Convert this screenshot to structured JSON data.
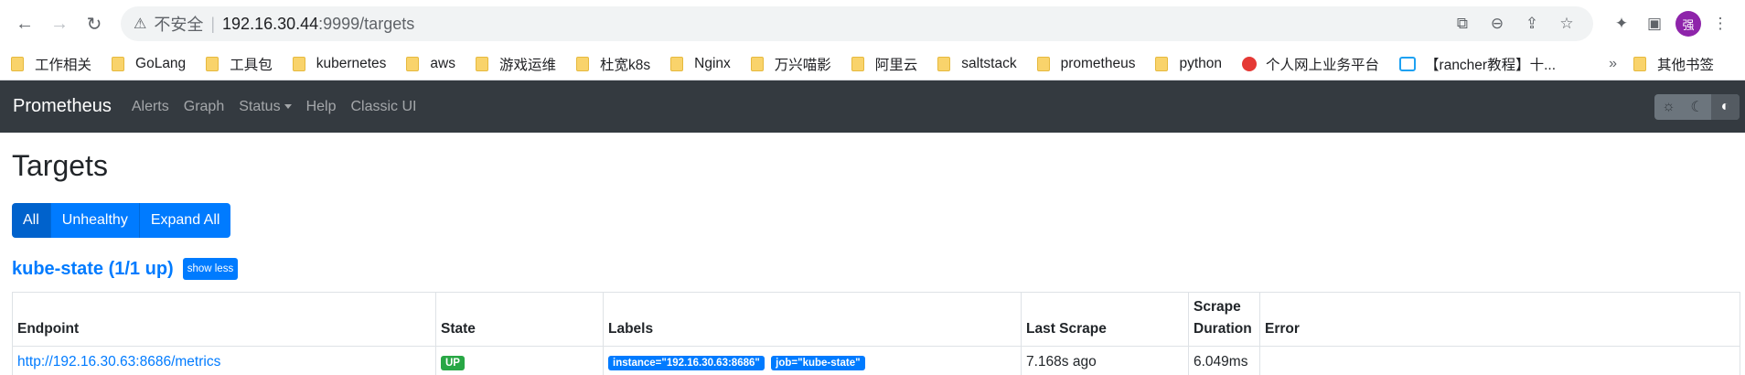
{
  "browser": {
    "address": {
      "security_label": "不安全",
      "separator": "|",
      "host": "192.16.30.44",
      "path": ":9999/targets"
    },
    "avatar_text": "强",
    "bookmarks": [
      {
        "label": "工作相关",
        "icon": "folder"
      },
      {
        "label": "GoLang",
        "icon": "folder"
      },
      {
        "label": "工具包",
        "icon": "folder"
      },
      {
        "label": "kubernetes",
        "icon": "folder"
      },
      {
        "label": "aws",
        "icon": "folder"
      },
      {
        "label": "游戏运维",
        "icon": "folder"
      },
      {
        "label": "杜宽k8s",
        "icon": "folder"
      },
      {
        "label": "Nginx",
        "icon": "folder"
      },
      {
        "label": "万兴喵影",
        "icon": "folder"
      },
      {
        "label": "阿里云",
        "icon": "folder"
      },
      {
        "label": "saltstack",
        "icon": "folder"
      },
      {
        "label": "prometheus",
        "icon": "folder"
      },
      {
        "label": "python",
        "icon": "folder"
      },
      {
        "label": "个人网上业务平台",
        "icon": "site-red"
      },
      {
        "label": "【rancher教程】十...",
        "icon": "site-bilibili"
      }
    ],
    "more_label": "»",
    "other_bookmarks": "其他书签"
  },
  "navbar": {
    "brand": "Prometheus",
    "links": [
      "Alerts",
      "Graph",
      "Status",
      "Help",
      "Classic UI"
    ],
    "theme_buttons": [
      "sun-icon",
      "moon-icon",
      "contrast-icon"
    ]
  },
  "page": {
    "title": "Targets",
    "filters": [
      "All",
      "Unhealthy",
      "Expand All"
    ],
    "active_filter": "All"
  },
  "pool": {
    "title": "kube-state (1/1 up)",
    "toggle_label": "show less",
    "columns": [
      "Endpoint",
      "State",
      "Labels",
      "Last Scrape",
      "Scrape Duration",
      "Error"
    ],
    "rows": [
      {
        "endpoint": "http://192.16.30.63:8686/metrics",
        "state": "UP",
        "labels": [
          "instance=\"192.16.30.63:8686\"",
          "job=\"kube-state\""
        ],
        "last_scrape": "7.168s ago",
        "scrape_duration": "6.049ms",
        "error": ""
      }
    ]
  },
  "colors": {
    "primary": "#007bff",
    "success": "#28a745",
    "navbar": "#343a40"
  }
}
